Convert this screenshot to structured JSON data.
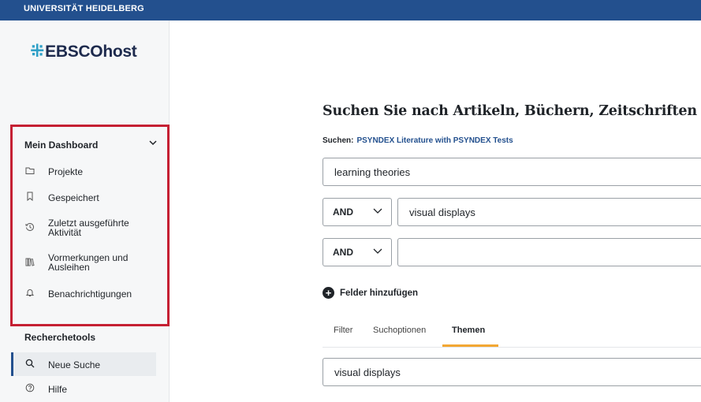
{
  "header": {
    "university": "UNIVERSITÄT HEIDELBERG"
  },
  "sidebar": {
    "logo": {
      "mark": "⁜",
      "text": "EBSCOhost"
    },
    "dashboard": {
      "title": "Mein Dashboard",
      "items": [
        {
          "icon": "folder-icon",
          "label": "Projekte"
        },
        {
          "icon": "bookmark-icon",
          "label": "Gespeichert"
        },
        {
          "icon": "history-icon",
          "label": "Zuletzt ausgeführte Aktivität",
          "lines": [
            "Zuletzt ausgeführte",
            "Aktivität"
          ]
        },
        {
          "icon": "books-icon",
          "label": "Vormerkungen und Ausleihen",
          "lines": [
            "Vormerkungen und",
            "Ausleihen"
          ]
        },
        {
          "icon": "bell-icon",
          "label": "Benachrichtigungen"
        }
      ]
    },
    "research_tools": {
      "title": "Recherchetools",
      "items": [
        {
          "icon": "search-icon",
          "label": "Neue Suche",
          "active": true
        },
        {
          "icon": "help-icon",
          "label": "Hilfe"
        }
      ]
    }
  },
  "main": {
    "headline": "Suchen Sie nach Artikeln, Büchern, Zeitschriften",
    "source_label": "Suchen:",
    "source_db": "PSYNDEX Literature with PSYNDEX Tests",
    "rows": [
      {
        "value": "learning theories"
      },
      {
        "operator": "AND",
        "value": "visual displays"
      },
      {
        "operator": "AND",
        "value": ""
      }
    ],
    "add_fields": "Felder hinzufügen",
    "tabs": [
      {
        "label": "Filter"
      },
      {
        "label": "Suchoptionen"
      },
      {
        "label": "Themen",
        "active": true
      }
    ],
    "subject_value": "visual displays"
  },
  "colors": {
    "brand": "#23508e",
    "highlight": "#c52033",
    "tab_accent": "#f2a733"
  }
}
